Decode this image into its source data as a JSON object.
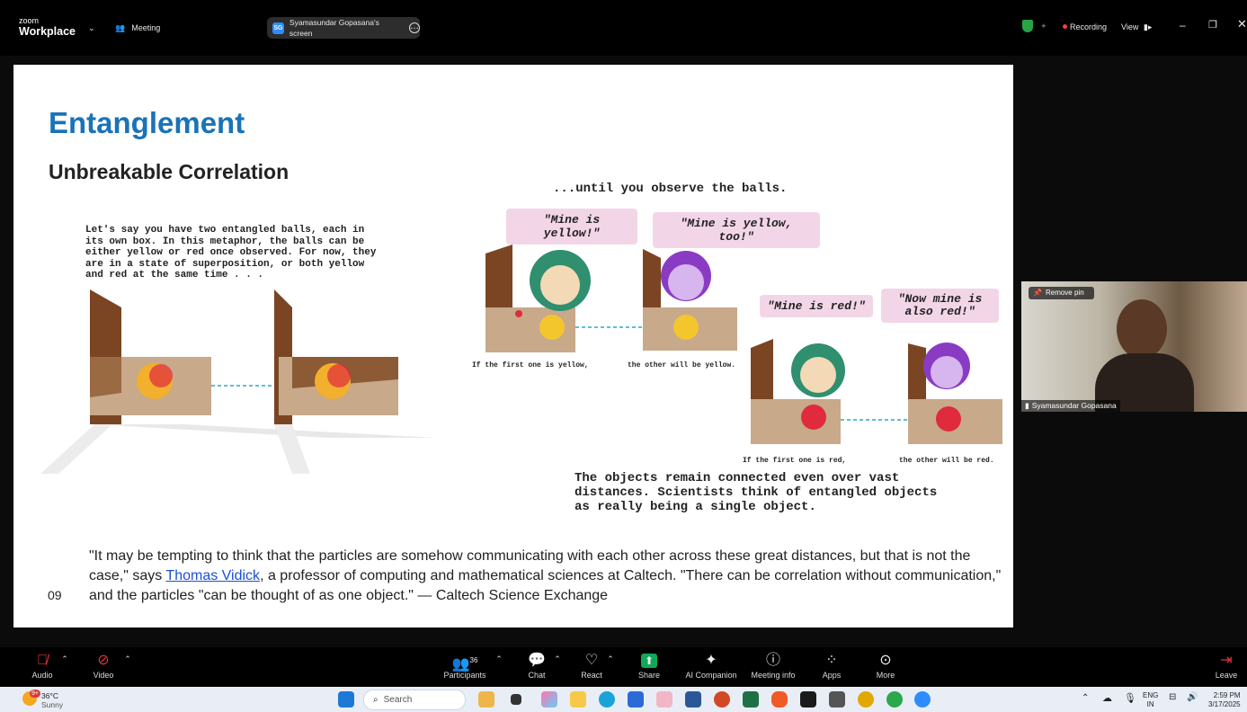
{
  "topbar": {
    "brand_small": "zoom",
    "brand_large": "Workplace",
    "meeting_label": "Meeting",
    "screen_badge": "SG",
    "screen_label": "Syamasundar Gopasana's screen",
    "recording_label": "Recording",
    "view_label": "View",
    "colors": {
      "shield": "#27a349",
      "recording_dot": "#ff3b3b"
    }
  },
  "slide": {
    "title": "Entanglement",
    "subtitle": "Unbreakable Correlation",
    "intro_text": "Let's say you have two entangled balls, each in its own box. In this metaphor, the balls can be either yellow or red once observed. For now, they are in a state of superposition, or both yellow and red at the same time . . .",
    "observe_header": "...until you observe the balls.",
    "bubbles": {
      "yellow1": "\"Mine is yellow!\"",
      "yellow2": "\"Mine is yellow, too!\"",
      "red1": "\"Mine is red!\"",
      "red2": "\"Now mine is also red!\""
    },
    "captions": {
      "yellow_left": "If the first one is yellow,",
      "yellow_right": "the other will be yellow.",
      "red_left": "If the first one is red,",
      "red_right": "the other will be red."
    },
    "conclusion": "The objects remain connected even over vast distances. Scientists think of entangled objects as really being a single object.",
    "quote_before": "\"It may be tempting to think that the particles are somehow communicating with each other across these great distances, but that is not the case,\" says ",
    "quote_link": "Thomas Vidick",
    "quote_after": ", a professor of computing and mathematical sciences at Caltech. \"There can be correlation without communication,\" and the particles \"can be thought of as one object.\" — Caltech Science Exchange",
    "page_number": "09",
    "colors": {
      "title": "#1a73b8",
      "bubble": "#f2d6e8",
      "link": "#1a4fd8"
    }
  },
  "video": {
    "remove_pin_label": "Remove pin",
    "participant_name": "Syamasundar Gopasana"
  },
  "controls": {
    "audio": "Audio",
    "video": "Video",
    "participants": "Participants",
    "participants_count": "36",
    "chat": "Chat",
    "react": "React",
    "share": "Share",
    "ai_companion": "AI Companion",
    "meeting_info": "Meeting info",
    "apps": "Apps",
    "more": "More",
    "leave": "Leave",
    "colors": {
      "share": "#0fa958",
      "muted": "#e5343a"
    }
  },
  "taskbar": {
    "weather_badge": "9+",
    "temperature": "36°C",
    "weather": "Sunny",
    "search_placeholder": "Search",
    "lang_line1": "ENG",
    "lang_line2": "IN",
    "time": "2:59 PM",
    "date": "3/17/2025"
  }
}
